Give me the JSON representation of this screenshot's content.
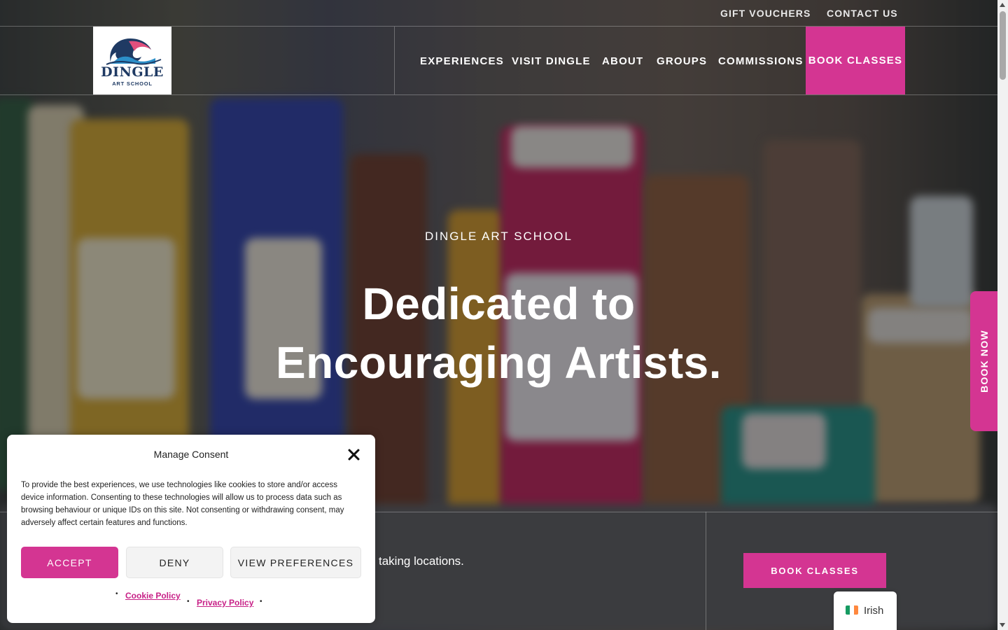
{
  "colors": {
    "accent": "#d43592",
    "link": "#c71f86"
  },
  "utility_nav": {
    "gift_vouchers": "GIFT VOUCHERS",
    "contact_us": "CONTACT US"
  },
  "logo": {
    "title": "DINGLE",
    "subtitle": "ART SCHOOL",
    "icon": "wave-icon"
  },
  "main_nav": {
    "items": [
      {
        "label": "EXPERIENCES"
      },
      {
        "label": "VISIT DINGLE"
      },
      {
        "label": "ABOUT"
      },
      {
        "label": "GROUPS"
      },
      {
        "label": "COMMISSIONS"
      }
    ],
    "cta": "BOOK CLASSES"
  },
  "hero": {
    "eyebrow": "DINGLE ART SCHOOL",
    "title_line1": "Dedicated to",
    "title_line2": "Encouraging Artists."
  },
  "band": {
    "text": "taking locations.",
    "cta": "BOOK CLASSES"
  },
  "side_tab": {
    "label": "BOOK NOW"
  },
  "language": {
    "label": "Irish",
    "flag": "ireland-flag-icon"
  },
  "consent": {
    "title": "Manage Consent",
    "body": "To provide the best experiences, we use technologies like cookies to store and/or access device information. Consenting to these technologies will allow us to process data such as browsing behaviour or unique IDs on this site. Not consenting or withdrawing consent, may adversely affect certain features and functions.",
    "accept": "ACCEPT",
    "deny": "DENY",
    "preferences": "VIEW PREFERENCES",
    "cookie_policy": "Cookie Policy",
    "privacy_policy": "Privacy Policy",
    "bullet": "•"
  }
}
